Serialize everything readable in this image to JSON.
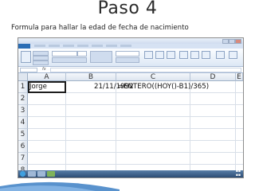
{
  "slide": {
    "title": "Paso 4",
    "subtitle": "Formula para hallar la edad de fecha de nacimiento"
  },
  "spreadsheet": {
    "columns": [
      "A",
      "B",
      "C",
      "D",
      "E"
    ],
    "rows": [
      "1",
      "2",
      "3",
      "4",
      "5",
      "6",
      "7",
      "8"
    ],
    "cells": {
      "A1": "Jorge",
      "B1": "21/11/1992",
      "C1": "=ENTERO((HOY()-B1)/365)"
    },
    "selected_cell": "A1"
  },
  "colors": {
    "ribbon": "#dde8f5",
    "file_tab": "#2a6db5",
    "taskbar": "#2c4d75",
    "swoosh": "#3c7fc4"
  }
}
